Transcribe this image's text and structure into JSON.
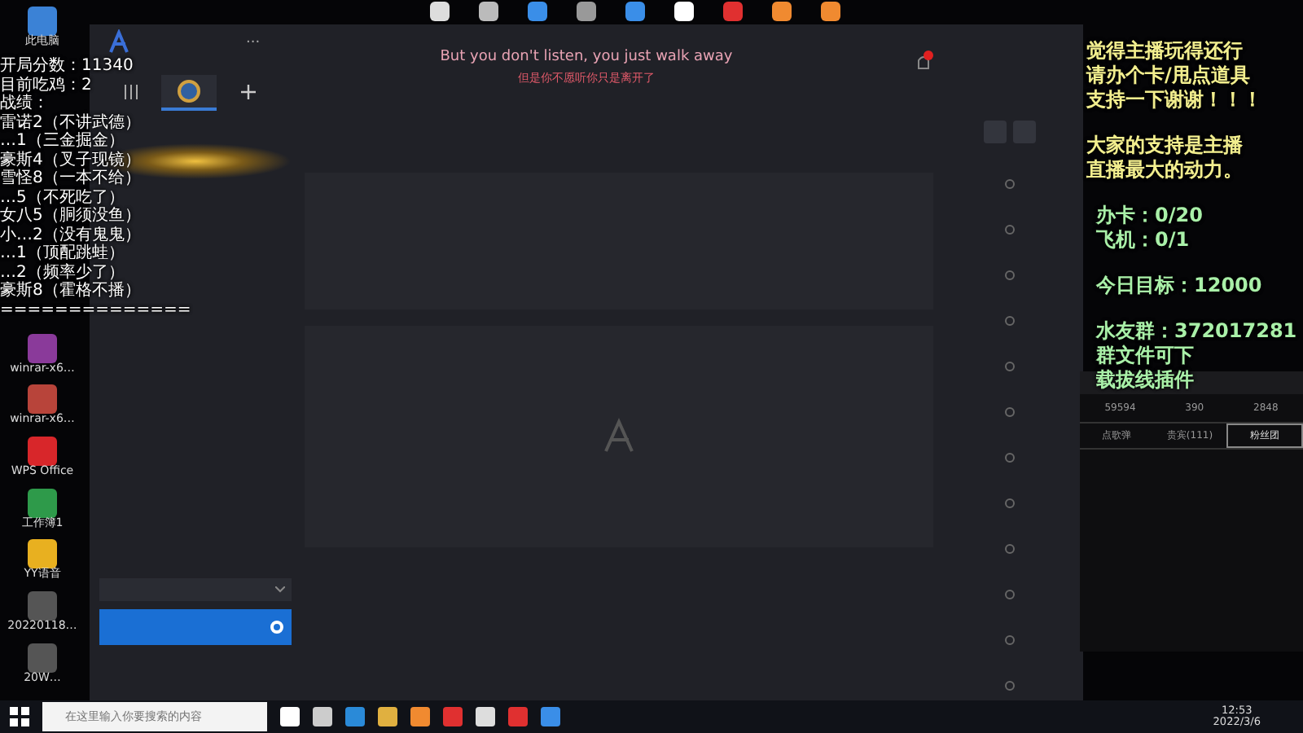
{
  "desktop_icons": [
    {
      "label": "此电脑",
      "color": "#3b82d6"
    },
    {
      "label": "winrar-x6…",
      "color": "#8a3a9a"
    },
    {
      "label": "winrar-x6…",
      "color": "#b8443a"
    },
    {
      "label": "WPS Office",
      "color": "#d8262a"
    },
    {
      "label": "工作簿1",
      "color": "#2e9a4a"
    },
    {
      "label": "YY语音",
      "color": "#e8b020"
    },
    {
      "label": "20220118…",
      "color": "#555555"
    },
    {
      "label": "20W…",
      "color": "#555555"
    }
  ],
  "app_window": {
    "lyrics": {
      "line": "But you don't listen, you just walk away",
      "translation": "但是你不愿听你只是离开了"
    },
    "has_notification": true,
    "tabs": [
      {
        "kind": "grid",
        "selected": false
      },
      {
        "kind": "game",
        "selected": true
      },
      {
        "kind": "add",
        "selected": false
      }
    ],
    "more_label": "..."
  },
  "score_overlay": {
    "lines": [
      "开局分数：11340",
      "目前吃鸡：2",
      "战绩：",
      "雷诺2（不讲武德）",
      "…1（三金掘金）",
      "豪斯4（叉子现镜）",
      "雪怪8（一本不给）",
      "…5（不死吃了）",
      "女八5（胴须没鱼）",
      "小…2（没有鬼鬼）",
      "…1（顶配跳蛙）",
      "…2（频率少了）",
      "豪斯8（霍格不播）",
      "=============="
    ]
  },
  "support_overlay": {
    "groups": [
      {
        "kind": "notice",
        "lines": [
          "觉得主播玩得还行",
          "请办个卡/甩点道具",
          "支持一下谢谢！！！"
        ]
      },
      {
        "kind": "notice",
        "lines": [
          "大家的支持是主播",
          "直播最大的动力。"
        ]
      },
      {
        "kind": "stat",
        "lines": [
          "办卡：0/20",
          "飞机：0/1"
        ]
      },
      {
        "kind": "stat",
        "lines": [
          "今日目标：12000"
        ]
      },
      {
        "kind": "stat",
        "lines": [
          "水友群：372017281",
          "群文件可下",
          "载拔线插件"
        ]
      }
    ]
  },
  "chat_panel": {
    "stats": [
      "59594",
      "390",
      "2848"
    ],
    "tabs": [
      {
        "label": "点歌弹",
        "selected": false
      },
      {
        "label": "贵宾(111)",
        "selected": false
      },
      {
        "label": "粉丝团",
        "selected": true
      }
    ]
  },
  "taskbar": {
    "search_placeholder": "在这里输入你要搜索的内容",
    "time": "12:53",
    "date": "2022/3/6"
  }
}
